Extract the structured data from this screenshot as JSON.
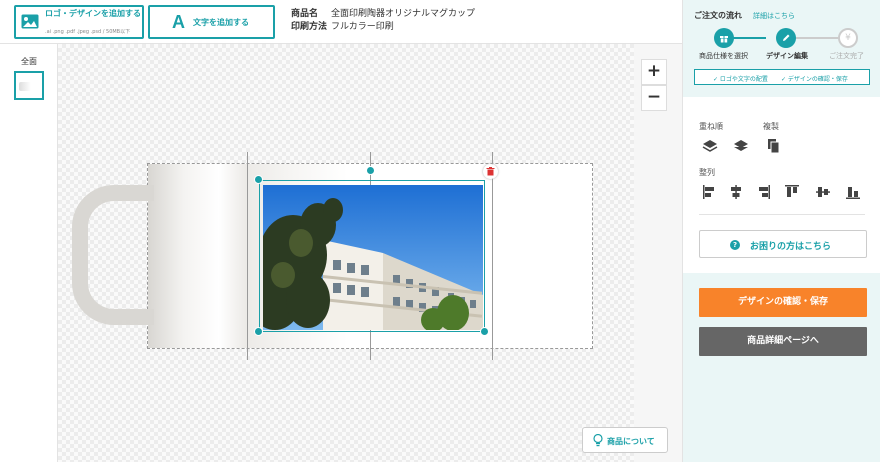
{
  "toolbar": {
    "upload_label": "ロゴ・デザインを追加する",
    "upload_sub": ".ai .png .pdf .jpeg .psd / 50MB以下",
    "text_icon": "A",
    "text_label": "文字を追加する"
  },
  "product": {
    "name_key": "商品名",
    "name_value": "全面印刷陶器オリジナルマグカップ",
    "method_key": "印刷方法",
    "method_value": "フルカラー印刷"
  },
  "side": {
    "label": "全面"
  },
  "canvas": {
    "zoom_in": "+",
    "zoom_out": "−",
    "about_label": "商品について",
    "trash_icon": "trash-icon"
  },
  "panel": {
    "flow_title": "ご注文の流れ",
    "flow_detail": "詳細はこちら",
    "steps": [
      {
        "label": "商品仕様を選択",
        "icon": "gift-icon",
        "state": "done"
      },
      {
        "label": "デザイン編集",
        "icon": "pencil-icon",
        "state": "current"
      },
      {
        "label": "ご注文完了",
        "icon": "yen-icon",
        "state": "pending"
      }
    ],
    "check1": "✓ ロゴや文字の配置",
    "check2": "✓ デザインの確認・保存",
    "layer_label": "重ね順",
    "copy_label": "複製",
    "align_label": "整列",
    "help_label": "お困りの方はこちら",
    "save_label": "デザインの確認・保存",
    "detail_label": "商品詳細ページへ"
  },
  "colors": {
    "accent": "#1aa0a8",
    "save_button": "#f8832a",
    "detail_button": "#666666"
  }
}
